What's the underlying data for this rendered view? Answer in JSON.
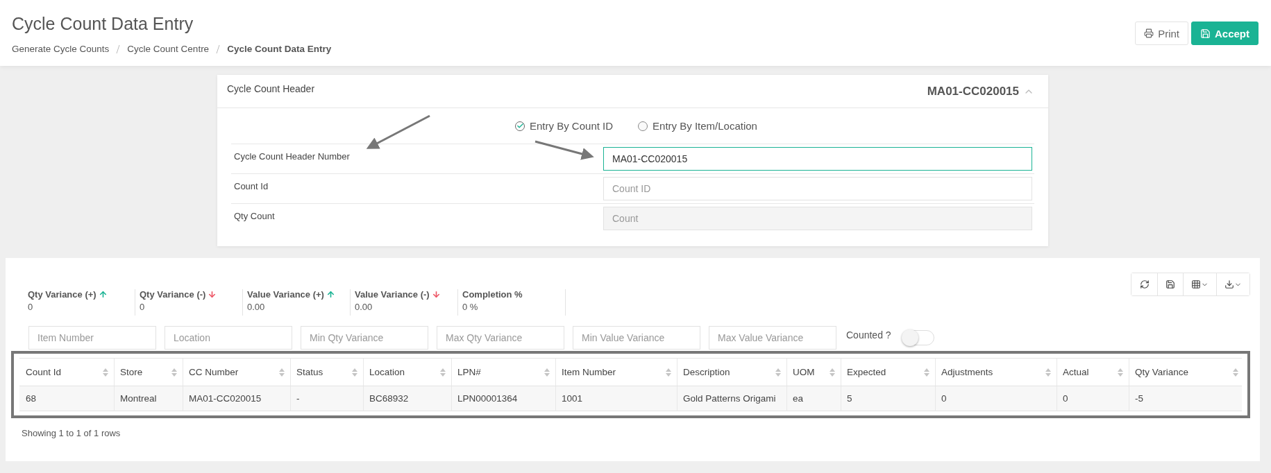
{
  "page": {
    "title": "Cycle Count Data Entry",
    "breadcrumb": [
      {
        "label": "Generate Cycle Counts",
        "current": false
      },
      {
        "label": "Cycle Count Centre",
        "current": false
      },
      {
        "label": "Cycle Count Data Entry",
        "current": true
      }
    ]
  },
  "actions": [
    {
      "kind": "print",
      "label": "Print"
    },
    {
      "kind": "accept",
      "label": "Accept"
    }
  ],
  "header_card": {
    "title": "Cycle Count Header",
    "id": "MA01-CC020015",
    "expanded": true,
    "entry_modes": [
      {
        "label": "Entry By Count ID",
        "selected": true
      },
      {
        "label": "Entry By Item/Location",
        "selected": false
      }
    ],
    "fields": [
      {
        "label": "Cycle Count Header Number",
        "value": "MA01-CC020015",
        "kind": "focused"
      },
      {
        "label": "Count Id",
        "placeholder": "Count ID",
        "kind": "plain"
      },
      {
        "label": "Qty Count",
        "placeholder": "Count",
        "kind": "disabled"
      }
    ]
  },
  "results": {
    "toolbar": [
      {
        "kind": "refresh"
      },
      {
        "kind": "save"
      },
      {
        "kind": "columns"
      },
      {
        "kind": "export"
      }
    ],
    "stats": [
      {
        "label": "Qty Variance (+)",
        "kind": "up",
        "value": "0"
      },
      {
        "label": "Qty Variance (-)",
        "kind": "down",
        "value": "0"
      },
      {
        "label": "Value Variance (+)",
        "kind": "up",
        "value": "0.00"
      },
      {
        "label": "Value Variance (-)",
        "kind": "down",
        "value": "0.00"
      },
      {
        "label": "Completion %",
        "kind": "plain",
        "value": "0 %"
      }
    ],
    "filters": [
      {
        "placeholder": "Item Number"
      },
      {
        "placeholder": "Location"
      },
      {
        "placeholder": "Min Qty Variance"
      },
      {
        "placeholder": "Max Qty Variance"
      },
      {
        "placeholder": "Min Value Variance"
      },
      {
        "placeholder": "Max Value Variance"
      }
    ],
    "counted": {
      "label": "Counted ?",
      "on": false
    },
    "table": {
      "columns": [
        "Count Id",
        "Store",
        "CC Number",
        "Status",
        "Location",
        "LPN#",
        "Item Number",
        "Description",
        "UOM",
        "Expected",
        "Adjustments",
        "Actual",
        "Qty Variance"
      ],
      "rows": [
        [
          "68",
          "Montreal",
          "MA01-CC020015",
          "-",
          "BC68932",
          "LPN00001364",
          "1001",
          "Gold Patterns Origami",
          "ea",
          "5",
          "0",
          "0",
          "-5"
        ]
      ]
    },
    "footer": "Showing 1 to 1 of 1 rows"
  }
}
